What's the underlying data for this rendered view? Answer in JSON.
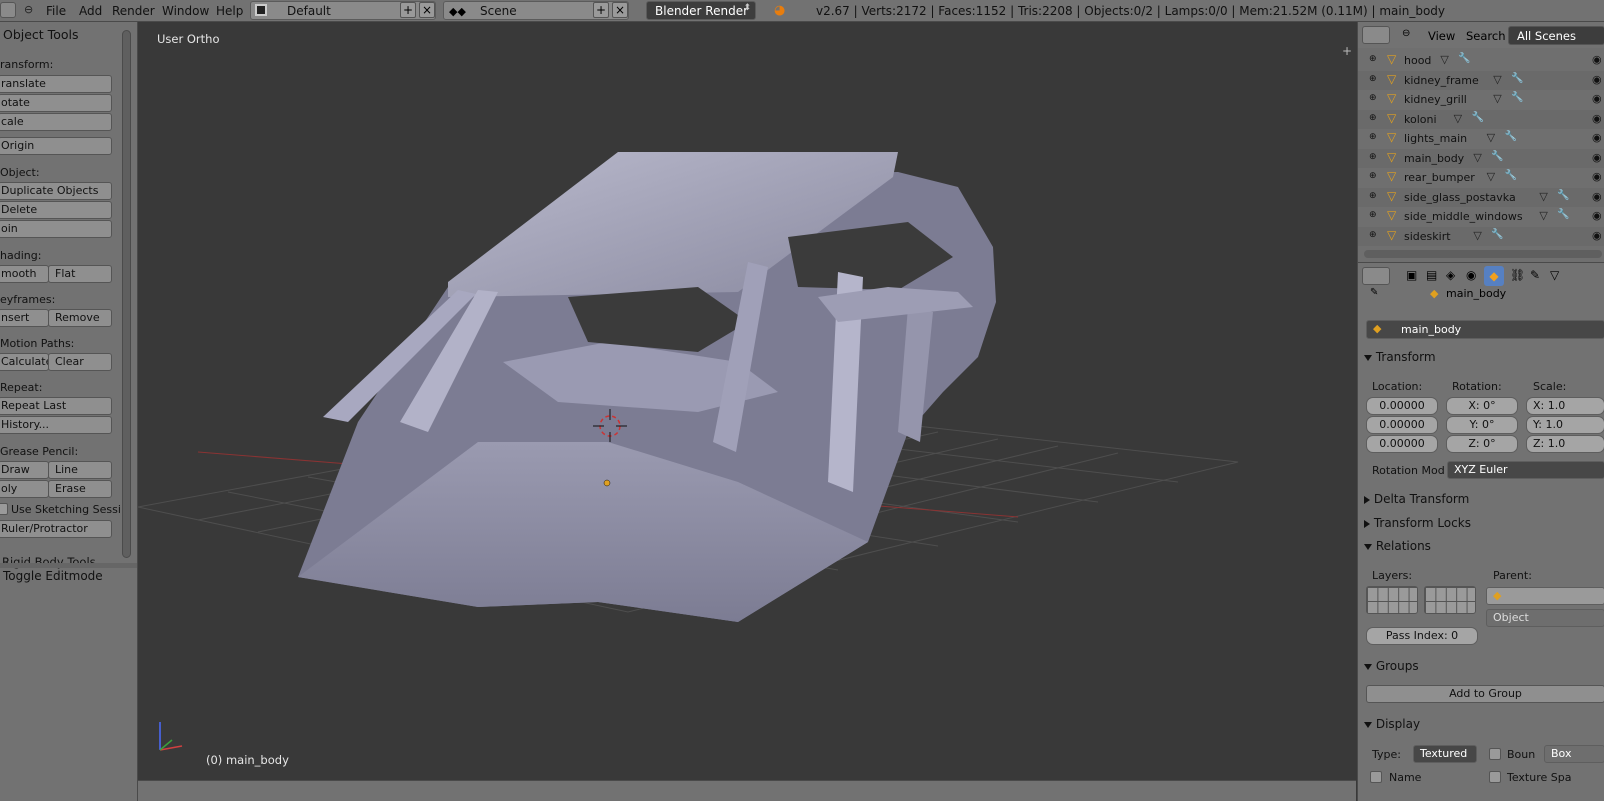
{
  "top": {
    "menus": [
      "File",
      "Add",
      "Render",
      "Window",
      "Help"
    ],
    "screen_layout": "Default",
    "scene": "Scene",
    "render_engine": "Blender Render",
    "stats": "v2.67 | Verts:2172 | Faces:1152 | Tris:2208 | Objects:0/2 | Lamps:0/0 | Mem:21.52M (0.11M) | main_body"
  },
  "toolshelf": {
    "title": "Object Tools",
    "transform_label": "ransform:",
    "translate": "ranslate",
    "rotate": "otate",
    "scale": "cale",
    "origin": "Origin",
    "object_label": "Object:",
    "duplicate": "Duplicate Objects",
    "delete": "Delete",
    "join": "oin",
    "shading_label": "hading:",
    "smooth": "mooth",
    "flat": "Flat",
    "keyframes_label": "eyframes:",
    "insert": "nsert",
    "remove": "Remove",
    "motion_label": "Motion Paths:",
    "calculate": "Calculate",
    "clear": "Clear",
    "repeat_label": "Repeat:",
    "repeat_last": "Repeat Last",
    "history": "History...",
    "grease_label": "Grease Pencil:",
    "draw": "Draw",
    "line": "Line",
    "poly": "oly",
    "erase": "Erase",
    "use_sketching": "Use Sketching Sessi",
    "ruler": "Ruler/Protractor",
    "rigid_body": "Rigid Body Tools",
    "toggle_editmode": "Toggle Editmode"
  },
  "viewport": {
    "view_name": "User Ortho",
    "object_info": "(0) main_body"
  },
  "outliner": {
    "view_menu": "View",
    "search_menu": "Search",
    "filter": "All Scenes",
    "items": [
      {
        "name": "hood"
      },
      {
        "name": "kidney_frame"
      },
      {
        "name": "kidney_grill"
      },
      {
        "name": "koloni"
      },
      {
        "name": "lights_main"
      },
      {
        "name": "main_body"
      },
      {
        "name": "rear_bumper"
      },
      {
        "name": "side_glass_postavka"
      },
      {
        "name": "side_middle_windows"
      },
      {
        "name": "sideskirt"
      }
    ]
  },
  "properties": {
    "breadcrumb": "main_body",
    "object_name": "main_body",
    "transform_header": "Transform",
    "location_label": "Location:",
    "rotation_label": "Rotation:",
    "scale_label": "Scale:",
    "location": [
      "0.00000",
      "0.00000",
      "0.00000"
    ],
    "rotation": [
      "X: 0°",
      "Y: 0°",
      "Z: 0°"
    ],
    "scale": [
      "X: 1.0",
      "Y: 1.0",
      "Z: 1.0"
    ],
    "rotation_mode_label": "Rotation Mod",
    "rotation_mode": "XYZ Euler",
    "delta_transform": "Delta Transform",
    "transform_locks": "Transform Locks",
    "relations_header": "Relations",
    "layers_label": "Layers:",
    "parent_label": "Parent:",
    "parent_type": "Object",
    "pass_index": "Pass Index: 0",
    "groups_header": "Groups",
    "add_to_group": "Add to Group",
    "display_header": "Display",
    "type_label": "Type:",
    "type_value": "Textured",
    "bounds_label": "Boun",
    "bounds_value": "Box",
    "name_label": "Name",
    "texture_space_label": "Texture Spa"
  }
}
